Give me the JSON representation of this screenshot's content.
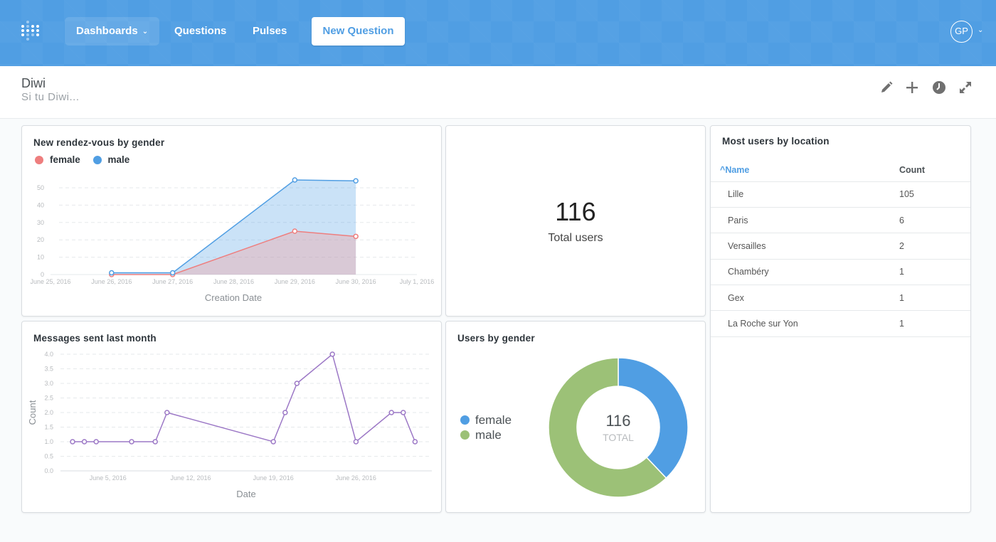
{
  "nav": {
    "logo": "metabase-logo-icon",
    "items": [
      {
        "label": "Dashboards",
        "has_dropdown": true,
        "active": true
      },
      {
        "label": "Questions"
      },
      {
        "label": "Pulses"
      }
    ],
    "new_question_label": "New Question",
    "user_initials": "GP"
  },
  "dashboard": {
    "title": "Diwi",
    "description": "Si tu Diwi...",
    "actions": [
      "pencil-icon",
      "plus-icon",
      "clock-icon",
      "expand-icon"
    ]
  },
  "colors": {
    "primary": "#509ee3",
    "female": "#ee7e7e",
    "male": "#509ee3",
    "purple": "#9c78c6",
    "pie_female": "#509ee3",
    "pie_male": "#9cc177"
  },
  "cards": {
    "rendezvous": {
      "title": "New rendez-vous by gender",
      "legend": [
        "female",
        "male"
      ]
    },
    "total_users": {
      "value": "116",
      "label": "Total users"
    },
    "location": {
      "title": "Most users by location",
      "columns": [
        "Name",
        "Count"
      ],
      "sort_indicator": "^",
      "rows": [
        [
          "Lille",
          "105"
        ],
        [
          "Paris",
          "6"
        ],
        [
          "Versailles",
          "2"
        ],
        [
          "Chambéry",
          "1"
        ],
        [
          "Gex",
          "1"
        ],
        [
          "La Roche sur Yon",
          "1"
        ]
      ]
    },
    "messages": {
      "title": "Messages sent last month"
    },
    "gender": {
      "title": "Users by gender",
      "legend": [
        "female",
        "male"
      ],
      "total": "116",
      "total_label": "TOTAL"
    }
  },
  "chart_data": [
    {
      "type": "area",
      "title": "New rendez-vous by gender",
      "xlabel": "Creation Date",
      "ylabel": "",
      "x_ticks": [
        "June 25, 2016",
        "June 26, 2016",
        "June 27, 2016",
        "June 28, 2016",
        "June 29, 2016",
        "June 30, 2016",
        "July 1, 2016"
      ],
      "y_ticks": [
        0,
        10,
        20,
        30,
        40,
        50
      ],
      "ylim": [
        0,
        55
      ],
      "stacked": false,
      "grid": true,
      "legend": "top-left",
      "x": [
        "June 26, 2016",
        "June 27, 2016",
        "June 29, 2016",
        "June 30, 2016"
      ],
      "x_index": [
        1,
        2,
        4,
        5
      ],
      "series": [
        {
          "name": "female",
          "values": [
            0,
            0,
            25,
            22
          ]
        },
        {
          "name": "male",
          "values": [
            1,
            1,
            54.5,
            54
          ]
        }
      ]
    },
    {
      "type": "line",
      "title": "Messages sent last month",
      "xlabel": "Date",
      "ylabel": "Count",
      "x_ticks": [
        "June 5, 2016",
        "June 12, 2016",
        "June 19, 2016",
        "June 26, 2016"
      ],
      "y_ticks": [
        "0.0",
        "0.5",
        "1.0",
        "1.5",
        "2.0",
        "2.5",
        "3.0",
        "3.5",
        "4.0"
      ],
      "ylim": [
        0,
        4
      ],
      "grid": true,
      "x_day": [
        2,
        3,
        4,
        7,
        9,
        10,
        19,
        20,
        21,
        24,
        26,
        29,
        30,
        31
      ],
      "x": [
        "June 2",
        "June 3",
        "June 4",
        "June 7",
        "June 9",
        "June 10",
        "June 19",
        "June 20",
        "June 21",
        "June 24",
        "June 26",
        "June 29",
        "June 30",
        "July 1"
      ],
      "series": [
        {
          "name": "Count",
          "values": [
            1,
            1,
            1,
            1,
            1,
            2,
            1,
            2,
            3,
            4,
            1,
            2,
            2,
            1
          ]
        }
      ]
    },
    {
      "type": "pie",
      "title": "Users by gender",
      "donut": true,
      "total": 116,
      "slices": [
        {
          "label": "female",
          "value": 44
        },
        {
          "label": "male",
          "value": 72
        }
      ]
    }
  ]
}
